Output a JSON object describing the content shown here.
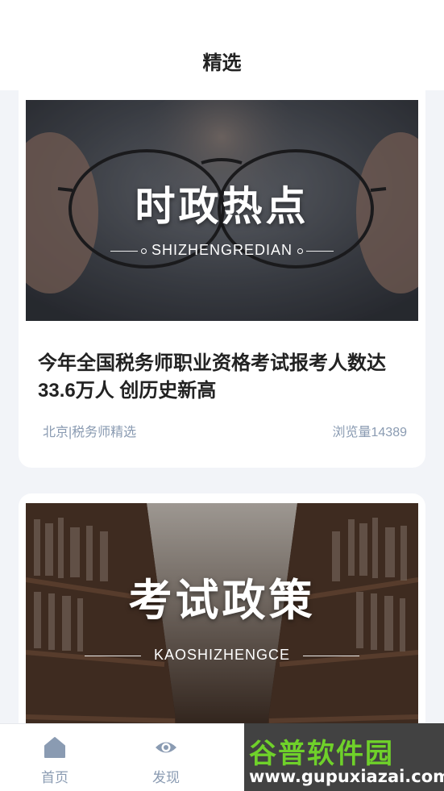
{
  "header": {
    "title": "精选"
  },
  "articles": [
    {
      "banner_title": "时政热点",
      "banner_subtitle": "SHIZHENGREDIAN",
      "title": "今年全国税务师职业资格考试报考人数达33.6万人 创历史新高",
      "source": "北京|税务师精选",
      "views": "浏览量14389"
    },
    {
      "banner_title": "考试政策",
      "banner_subtitle": "KAOSHIZHENGCE"
    }
  ],
  "tabbar": {
    "items": [
      {
        "label": "首页",
        "icon": "home-icon"
      },
      {
        "label": "发现",
        "icon": "eye-icon"
      }
    ]
  },
  "watermark": {
    "brand": "谷普软件园",
    "url": "www.gupuxiazai.com"
  },
  "colors": {
    "background": "#f2f4f8",
    "card": "#ffffff",
    "meta_text": "#8a9bb2",
    "tab_icon": "#8a9bb2"
  }
}
